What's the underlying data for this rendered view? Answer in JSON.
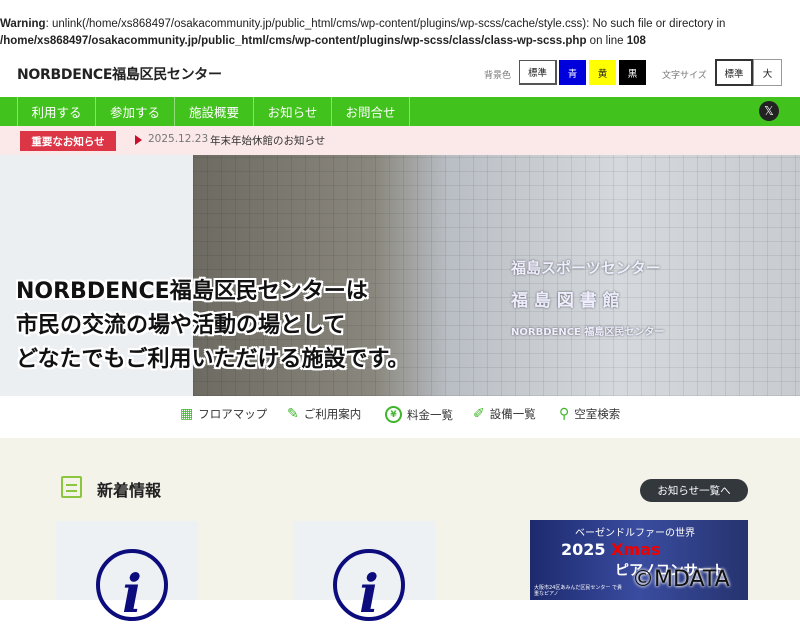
{
  "warning": {
    "label": "Warning",
    "message": ": unlink(/home/xs868497/osakacommunity.jp/public_html/cms/wp-content/plugins/wp-scss/cache/style.css): No such file or directory in",
    "path": "/home/xs868497/osakacommunity.jp/public_html/cms/wp-content/plugins/wp-scss/class/class-wp-scss.php",
    "on_line": " on line ",
    "line": "108"
  },
  "header": {
    "title": "NORBDENCE福島区民センター",
    "bg_label": "背景色",
    "bg_options": [
      "標準",
      "青",
      "黄",
      "黒"
    ],
    "size_label": "文字サイズ",
    "size_options": [
      "標準",
      "大"
    ]
  },
  "nav": {
    "items": [
      "利用する",
      "参加する",
      "施設概要",
      "お知らせ",
      "お問合せ"
    ],
    "x_icon": "𝕏"
  },
  "notice": {
    "badge": "重要なお知らせ",
    "date": "2025.12.23",
    "text": "年末年始休館のお知らせ"
  },
  "hero": {
    "lines": [
      "NORBDENCE福島区民センターは",
      "市民の交流の場や活動の場として",
      "どなたでもご利用いただける施設です。"
    ],
    "sign1": "福島スポーツセンター",
    "sign2": "福 島 図 書 館",
    "sign3": "NORBDENCE 福島区民センター"
  },
  "quick_links": [
    {
      "icon": "▦",
      "label": "フロアマップ"
    },
    {
      "icon": "✎",
      "label": "ご利用案内"
    },
    {
      "icon": "¥",
      "label": "料金一覧"
    },
    {
      "icon": "✐",
      "label": "設備一覧"
    },
    {
      "icon": "⚲",
      "label": "空室検索"
    }
  ],
  "news": {
    "title": "新着情報",
    "more": "お知らせ一覧へ",
    "info_glyph": "i"
  },
  "poster": {
    "line1": "ベーゼンドルファーの世界",
    "year": "2025 ",
    "xmas": "Xmas",
    "line3": "ピアノコンサート",
    "small": "大阪市24区あみんだ区民センター で貴重なピアノ"
  },
  "copyright": "©MDATA",
  "colors": {
    "nav": "#42c21c",
    "badge": "#dc3545",
    "blue": "#0000dd",
    "yellow": "#ffff00",
    "black": "#000000"
  }
}
